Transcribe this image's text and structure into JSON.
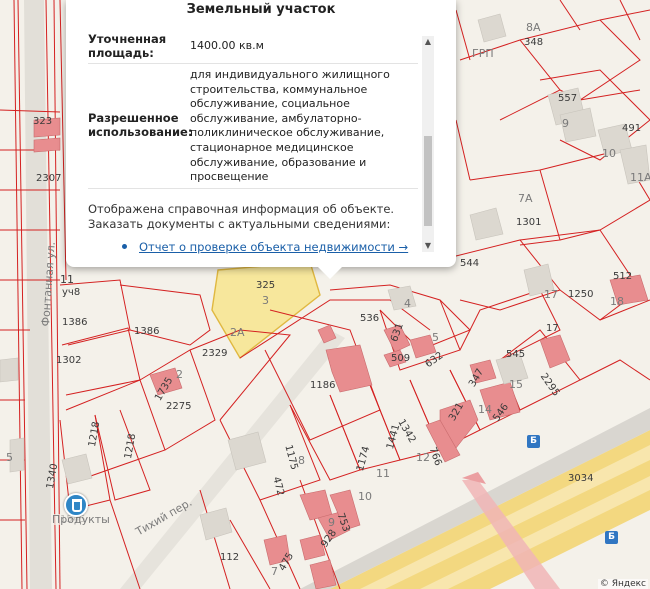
{
  "popup": {
    "title": "Земельный участок",
    "area_label_line1": "Уточненная",
    "area_label_line2": "площадь:",
    "area_value": "1400.00 кв.м",
    "usage_label_line1": "Разрешенное",
    "usage_label_line2": "использование:",
    "usage_lines": [
      "для индивидуального жилищного",
      "строительства, коммунальное",
      "обслуживание, социальное",
      "обслуживание, амбулаторно-",
      "поликлиническое обслуживание,",
      "стационарное медицинское",
      "обслуживание, образование и",
      "просвещение"
    ],
    "info_line1": "Отображена справочная информация об объекте.",
    "info_line2": "Заказать документы с актуальными сведениями:",
    "report_link": "Отчет о проверке объекта недвижимости →"
  },
  "map": {
    "selected_parcel": {
      "number": "325",
      "sub": "3",
      "sub2": "2А"
    },
    "streets": {
      "fontannaya": "Фонтанная ул.",
      "tihiy": "Тихий пер."
    },
    "poi": {
      "shop": "Продукты",
      "grp": "ГРП"
    },
    "attribution": "© Яндекс",
    "parcel_labels": [
      "8А",
      "348",
      "557",
      "9",
      "491",
      "10",
      "11А",
      "7А",
      "1301",
      "544",
      "512",
      "17",
      "1250",
      "18",
      "536",
      "631",
      "4",
      "5",
      "509",
      "632",
      "17",
      "545",
      "2295",
      "347",
      "15",
      "321",
      "14",
      "546",
      "1186",
      "1342",
      "766",
      "12",
      "1441",
      "1174",
      "11",
      "10",
      "1175",
      "8",
      "472",
      "753",
      "9",
      "928",
      "475",
      "7",
      "112",
      "3034",
      "2329",
      "2",
      "1735",
      "2275",
      "1386",
      "1302",
      "1386",
      "11",
      "уч8",
      "323",
      "2307",
      "1218",
      "1218",
      "1340",
      "1545",
      "5"
    ]
  },
  "colors": {
    "parcel_line": "#d42121",
    "building_fill": "#e88d8f",
    "selected_fill": "#f7e79c",
    "selected_line": "#e0b840",
    "road_yellow": "#f5d774",
    "link": "#1a5fa8"
  }
}
